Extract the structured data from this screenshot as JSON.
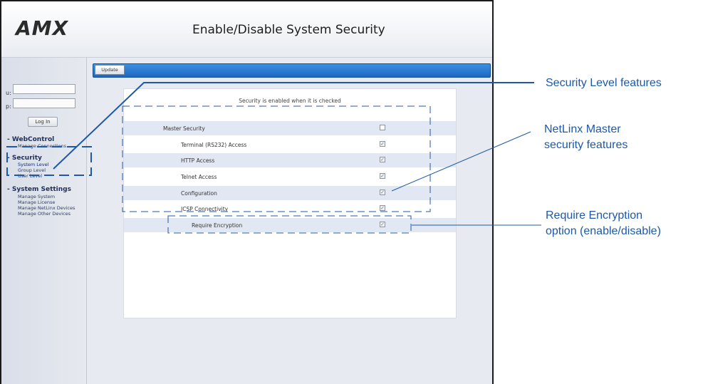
{
  "header": {
    "logo_text": "AMX",
    "title": "Enable/Disable System Security"
  },
  "login": {
    "username_label": "u:",
    "password_label": "p:",
    "username_value": "",
    "password_value": "",
    "login_button": "Log In"
  },
  "sidebar": {
    "sections": [
      {
        "title": "- WebControl",
        "items": [
          "Manage Connections"
        ]
      },
      {
        "title": "- Security",
        "items": [
          "System Level",
          "Group Level",
          "User Level"
        ],
        "active_item": "System Level"
      },
      {
        "title": "- System Settings",
        "items": [
          "Manage System",
          "Manage License",
          "Manage NetLinx Devices",
          "Manage Other Devices"
        ]
      }
    ]
  },
  "toolbar": {
    "update_button": "Update"
  },
  "security_panel": {
    "header": "Security is enabled when it is checked",
    "rows": [
      {
        "label": "Master Security",
        "checked": false
      },
      {
        "label": "Terminal (RS232) Access",
        "checked": true
      },
      {
        "label": "HTTP Access",
        "checked": true
      },
      {
        "label": "Telnet Access",
        "checked": true
      },
      {
        "label": "Configuration",
        "checked": true
      },
      {
        "label": "ICSP Connectivity",
        "checked": true
      },
      {
        "label": "Require Encryption",
        "checked": true
      }
    ]
  },
  "annotations": {
    "security_level_features": "Security Level features",
    "netlinx_line1": "NetLinx Master",
    "netlinx_line2": "security features",
    "encryption_line1": "Require Encryption",
    "encryption_line2": "option (enable/disable)"
  },
  "colors": {
    "annotation_blue": "#1d59a8",
    "toolbar_blue": "#2a7ad6",
    "row_shade": "#e2e8f3"
  }
}
